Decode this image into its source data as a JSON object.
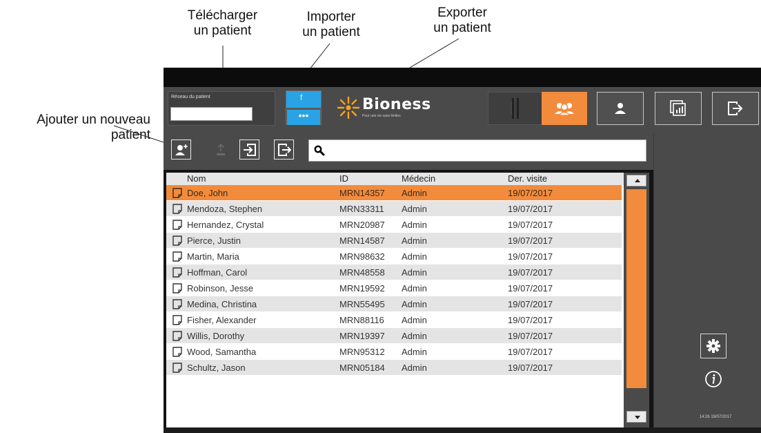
{
  "callouts": {
    "telecharger": [
      "Télécharger",
      "un patient"
    ],
    "importer": [
      "Importer",
      "un patient"
    ],
    "exporter": [
      "Exporter",
      "un patient"
    ],
    "ajouter": [
      "Ajouter un nouveau",
      "patient"
    ]
  },
  "header": {
    "network_label": "Réseau du patient",
    "network_value": "",
    "network_button_dots": "•••",
    "logo_name": "Bioness",
    "logo_tagline": "Pour une vie sans limites"
  },
  "icons": {
    "devices": "sensor-devices-icon",
    "patients": "patients-group-icon",
    "user": "user-icon",
    "reports": "reports-chart-icon",
    "logout": "logout-icon",
    "add": "add-patient-icon",
    "download": "download-patient-icon",
    "import": "import-patient-icon",
    "export": "export-patient-icon",
    "search": "search-icon",
    "settings": "gear-icon",
    "info": "info-icon"
  },
  "colors": {
    "accent": "#f38b3c",
    "network_blue": "#29a3e6",
    "panel": "#4a4a4a"
  },
  "search": {
    "value": "",
    "placeholder": ""
  },
  "table": {
    "columns": [
      "Nom",
      "ID",
      "Médecin",
      "Der. visite"
    ],
    "rows": [
      [
        "Doe, John",
        "MRN14357",
        "Admin",
        "19/07/2017"
      ],
      [
        "Mendoza, Stephen",
        "MRN33311",
        "Admin",
        "19/07/2017"
      ],
      [
        "Hernandez, Crystal",
        "MRN20987",
        "Admin",
        "19/07/2017"
      ],
      [
        "Pierce, Justin",
        "MRN14587",
        "Admin",
        "19/07/2017"
      ],
      [
        "Martin, Maria",
        "MRN98632",
        "Admin",
        "19/07/2017"
      ],
      [
        "Hoffman, Carol",
        "MRN48558",
        "Admin",
        "19/07/2017"
      ],
      [
        "Robinson, Jesse",
        "MRN19592",
        "Admin",
        "19/07/2017"
      ],
      [
        "Medina, Christina",
        "MRN55495",
        "Admin",
        "19/07/2017"
      ],
      [
        "Fisher, Alexander",
        "MRN88116",
        "Admin",
        "19/07/2017"
      ],
      [
        "Willis, Dorothy",
        "MRN19397",
        "Admin",
        "19/07/2017"
      ],
      [
        "Wood, Samantha",
        "MRN95312",
        "Admin",
        "19/07/2017"
      ],
      [
        "Schultz, Jason",
        "MRN05184",
        "Admin",
        "19/07/2017"
      ]
    ],
    "selected_row": 0
  },
  "status": {
    "datetime": "14:26 19/07/2017"
  }
}
